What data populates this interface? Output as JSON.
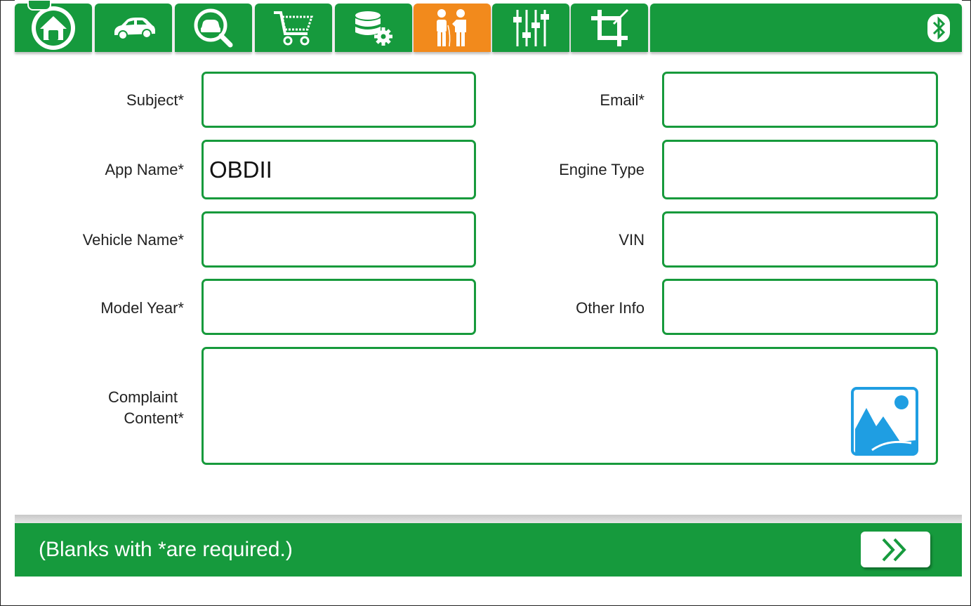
{
  "nav": {
    "tabs": [
      {
        "icon": "home-icon",
        "active": false
      },
      {
        "icon": "car-icon",
        "active": false
      },
      {
        "icon": "car-search-icon",
        "active": false
      },
      {
        "icon": "shopping-cart-icon",
        "active": false
      },
      {
        "icon": "database-settings-icon",
        "active": false
      },
      {
        "icon": "feedback-people-icon",
        "active": true
      },
      {
        "icon": "sliders-icon",
        "active": false
      },
      {
        "icon": "crop-icon",
        "active": false
      }
    ],
    "bluetooth_icon": "bluetooth-icon"
  },
  "form": {
    "subject": {
      "label": "Subject*",
      "value": ""
    },
    "email": {
      "label": "Email*",
      "value": ""
    },
    "app_name": {
      "label": "App Name*",
      "value": "OBDII"
    },
    "engine_type": {
      "label": "Engine Type",
      "value": ""
    },
    "vehicle_name": {
      "label": "Vehicle Name*",
      "value": ""
    },
    "vin": {
      "label": "VIN",
      "value": ""
    },
    "model_year": {
      "label": "Model Year*",
      "value": ""
    },
    "other_info": {
      "label": "Other Info",
      "value": ""
    },
    "complaint": {
      "label_line1": "Complaint",
      "label_line2": "Content*",
      "value": ""
    }
  },
  "footer": {
    "note": "(Blanks with *are required.)",
    "next_icon": "double-chevron-right-icon"
  },
  "colors": {
    "primary_green": "#169a3d",
    "active_orange": "#f28a1c",
    "image_blue": "#1f9ee2"
  }
}
